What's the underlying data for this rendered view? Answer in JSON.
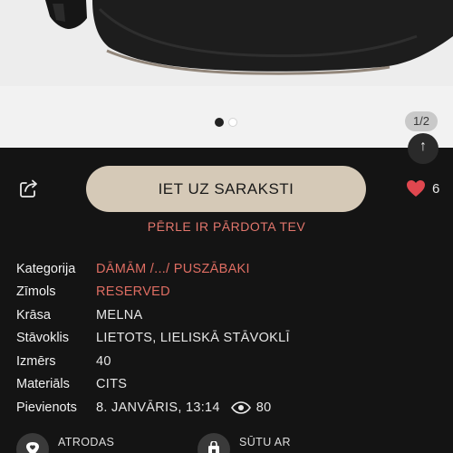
{
  "gallery": {
    "counter": "1/2",
    "dots": 2,
    "active_dot": 0
  },
  "actions": {
    "main_button": "IET UZ SARAKSTI",
    "likes": "6",
    "sold_notice": "PĒRLE IR PĀRDOTA TEV"
  },
  "details": [
    {
      "key": "Kategorija",
      "value": "DĀMĀM /.../ PUSZĀBAKI",
      "link": true
    },
    {
      "key": "Zīmols",
      "value": "RESERVED",
      "link": true
    },
    {
      "key": "Krāsa",
      "value": "MELNA",
      "link": false
    },
    {
      "key": "Stāvoklis",
      "value": "LIETOTS, LIELISKĀ STĀVOKLĪ",
      "link": false
    },
    {
      "key": "Izmērs",
      "value": "40",
      "link": false
    },
    {
      "key": "Materiāls",
      "value": "CITS",
      "link": false
    },
    {
      "key": "Pievienots",
      "value": "8. JANVĀRIS, 13:14",
      "link": false
    }
  ],
  "views": "80",
  "cards": {
    "location_label": "ATRODAS",
    "shipping_label": "SŪTU AR"
  },
  "colors": {
    "background": "#141414",
    "button": "#d5c9b7",
    "accent": "#de6d62",
    "heart": "#e0474f"
  },
  "icons": {
    "share": "share-icon",
    "heart": "heart-icon",
    "eye": "eye-icon",
    "location": "location-pin-icon",
    "shipping": "parcel-locker-icon"
  }
}
